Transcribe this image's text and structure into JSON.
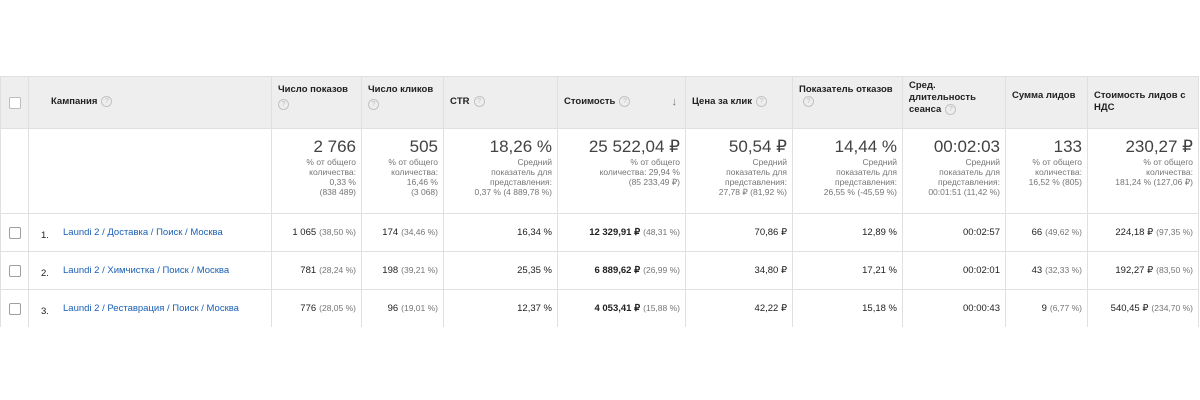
{
  "headers": [
    {
      "key": "campaign",
      "label": "Кампания"
    },
    {
      "key": "impressions",
      "label": "Число показов"
    },
    {
      "key": "clicks",
      "label": "Число кликов"
    },
    {
      "key": "ctr",
      "label": "CTR"
    },
    {
      "key": "cost",
      "label": "Стоимость"
    },
    {
      "key": "cpc",
      "label": "Цена за клик"
    },
    {
      "key": "bounce",
      "label": "Показатель отказов"
    },
    {
      "key": "duration",
      "label": "Сред. длительность сеанса"
    },
    {
      "key": "leads",
      "label": "Сумма лидов"
    },
    {
      "key": "lead_cost",
      "label": "Стоимость лидов с НДС"
    }
  ],
  "help_glyph": "?",
  "sort_glyph": "↓",
  "totals": [
    {
      "value": "2 766",
      "sub": [
        "% от общего",
        "количества:",
        "0,33 %",
        "(838 489)"
      ]
    },
    {
      "value": "505",
      "sub": [
        "% от общего",
        "количества:",
        "16,46 %",
        "(3 068)"
      ]
    },
    {
      "value": "18,26 %",
      "sub": [
        "Средний",
        "показатель для",
        "представления:",
        "0,37 % (4 889,78 %)"
      ]
    },
    {
      "value": "25 522,04 ₽",
      "sub": [
        "% от общего",
        "количества: 29,94 %",
        "(85 233,49 ₽)"
      ]
    },
    {
      "value": "50,54 ₽",
      "sub": [
        "Средний",
        "показатель для",
        "представления:",
        "27,78 ₽ (81,92 %)"
      ]
    },
    {
      "value": "14,44 %",
      "sub": [
        "Средний",
        "показатель для",
        "представления:",
        "26,55 % (-45,59 %)"
      ]
    },
    {
      "value": "00:02:03",
      "sub": [
        "Средний",
        "показатель для",
        "представления:",
        "00:01:51 (11,42 %)"
      ]
    },
    {
      "value": "133",
      "sub": [
        "% от общего",
        "количества:",
        "16,52 % (805)"
      ]
    },
    {
      "value": "230,27 ₽",
      "sub": [
        "% от общего",
        "количества:",
        "181,24 % (127,06 ₽)"
      ]
    }
  ],
  "rows": [
    {
      "num": "1.",
      "campaign": "Laundi 2 / Доставка / Поиск / Москва",
      "impressions": "1 065",
      "impressions_pct": "(38,50 %)",
      "clicks": "174",
      "clicks_pct": "(34,46 %)",
      "ctr": "16,34 %",
      "cost": "12 329,91 ₽",
      "cost_pct": "(48,31 %)",
      "cpc": "70,86 ₽",
      "bounce": "12,89 %",
      "duration": "00:02:57",
      "leads": "66",
      "leads_pct": "(49,62 %)",
      "lead_cost": "224,18 ₽",
      "lead_cost_pct": "(97,35 %)"
    },
    {
      "num": "2.",
      "campaign": "Laundi 2 / Химчистка / Поиск / Москва",
      "impressions": "781",
      "impressions_pct": "(28,24 %)",
      "clicks": "198",
      "clicks_pct": "(39,21 %)",
      "ctr": "25,35 %",
      "cost": "6 889,62 ₽",
      "cost_pct": "(26,99 %)",
      "cpc": "34,80 ₽",
      "bounce": "17,21 %",
      "duration": "00:02:01",
      "leads": "43",
      "leads_pct": "(32,33 %)",
      "lead_cost": "192,27 ₽",
      "lead_cost_pct": "(83,50 %)"
    },
    {
      "num": "3.",
      "campaign": "Laundi 2 / Реставрация / Поиск / Москва",
      "impressions": "776",
      "impressions_pct": "(28,05 %)",
      "clicks": "96",
      "clicks_pct": "(19,01 %)",
      "ctr": "12,37 %",
      "cost": "4 053,41 ₽",
      "cost_pct": "(15,88 %)",
      "cpc": "42,22 ₽",
      "bounce": "15,18 %",
      "duration": "00:00:43",
      "leads": "9",
      "leads_pct": "(6,77 %)",
      "lead_cost": "540,45 ₽",
      "lead_cost_pct": "(234,70 %)"
    }
  ],
  "colors": {
    "link": "#1a5fb4",
    "header_bg": "#eeeeee",
    "border": "#e0e0e0",
    "muted": "#757575"
  }
}
